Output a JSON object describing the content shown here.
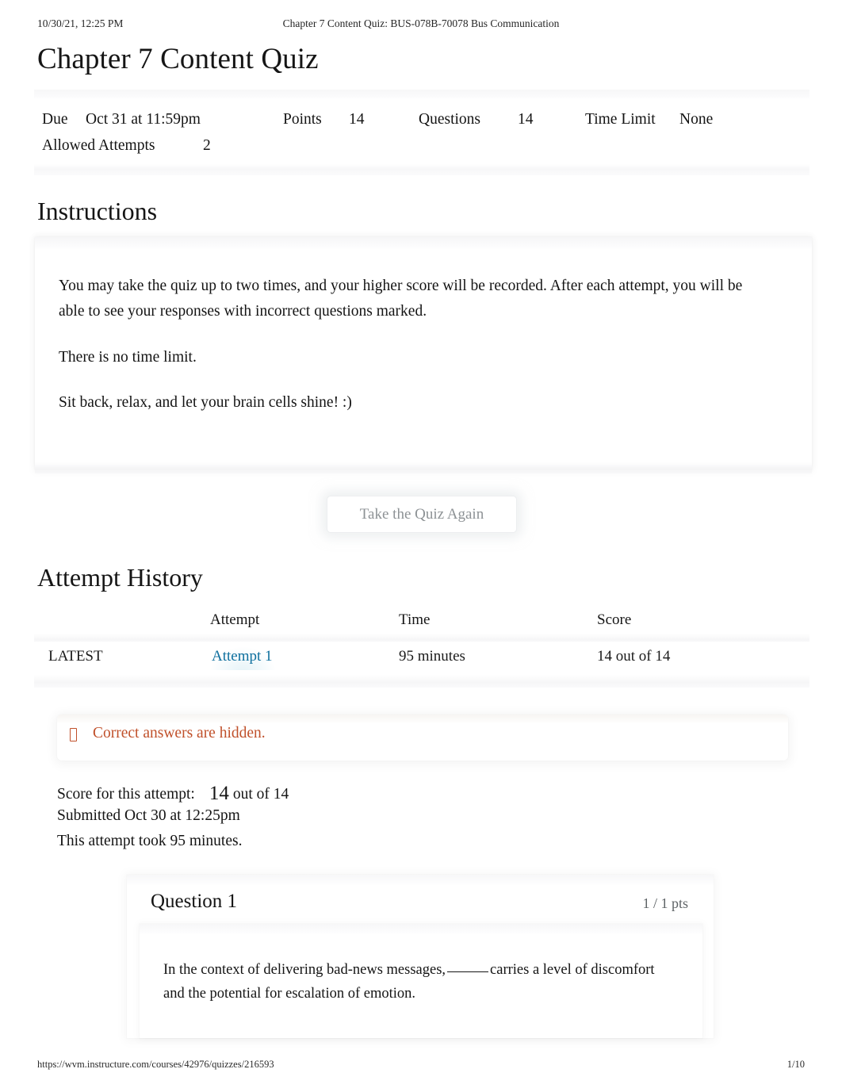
{
  "print": {
    "date": "10/30/21, 12:25 PM",
    "doc_title": "Chapter 7 Content Quiz: BUS-078B-70078 Bus Communication",
    "url": "https://wvm.instructure.com/courses/42976/quizzes/216593",
    "page": "1/10"
  },
  "quiz": {
    "title": "Chapter 7 Content Quiz",
    "details": {
      "due_label": "Due",
      "due_value": "Oct 31 at 11:59pm",
      "points_label": "Points",
      "points_value": "14",
      "questions_label": "Questions",
      "questions_value": "14",
      "time_limit_label": "Time Limit",
      "time_limit_value": "None",
      "allowed_attempts_label": "Allowed Attempts",
      "allowed_attempts_value": "2"
    }
  },
  "instructions": {
    "heading": "Instructions",
    "paragraphs": [
      "You may take the quiz up to two times, and your higher score will be recorded. After each attempt, you will be able to see your responses with incorrect questions marked.",
      "There is no time limit.",
      "Sit back, relax, and let your brain cells shine! :)"
    ]
  },
  "actions": {
    "take_again_label": "Take the Quiz Again"
  },
  "attempt_history": {
    "heading": "Attempt History",
    "columns": {
      "tag": "",
      "attempt": "Attempt",
      "time": "Time",
      "score": "Score"
    },
    "rows": [
      {
        "tag": "LATEST",
        "attempt": "Attempt 1",
        "time": "95 minutes",
        "score": "14 out of 14"
      }
    ]
  },
  "alert": {
    "icon": "warning-icon",
    "text": "Correct answers are hidden.",
    "color": "#c0502a"
  },
  "attempt_summary": {
    "score_label": "Score for this attempt:",
    "score_value": "14",
    "score_out_of": "out of 14",
    "submitted": "Submitted Oct 30 at 12:25pm",
    "duration": "This attempt took 95 minutes."
  },
  "questions": [
    {
      "title": "Question 1",
      "points": "1 / 1 pts",
      "text_before_blank": "In the context of delivering bad-news messages,",
      "text_after_blank": "carries a level of discomfort and the potential for escalation of emotion."
    }
  ],
  "colors": {
    "link": "#0e6f9e",
    "alert": "#c0502a",
    "muted": "#5e6366",
    "text": "#141414"
  }
}
